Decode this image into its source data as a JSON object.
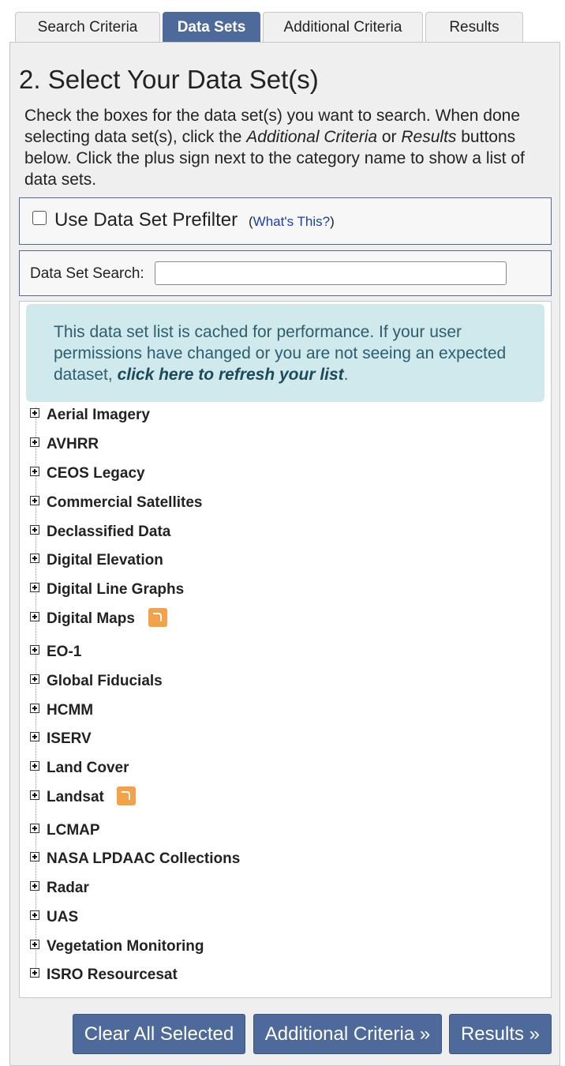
{
  "tabs": [
    "Search Criteria",
    "Data Sets",
    "Additional Criteria",
    "Results"
  ],
  "active_tab": "Data Sets",
  "title": "2. Select Your Data Set(s)",
  "intro": {
    "part1": "Check the boxes for the data set(s) you want to search. When done selecting data set(s), click the ",
    "em1": "Additional Criteria",
    "part2": " or ",
    "em2": "Results",
    "part3": " buttons below. Click the plus sign next to the category name to show a list of data sets."
  },
  "prefilter": {
    "label": "Use Data Set Prefilter",
    "help_open": "(",
    "help_link": "What's This?",
    "help_close": ")",
    "checked": false
  },
  "dataset_search": {
    "label": "Data Set Search:",
    "placeholder": "",
    "value": ""
  },
  "notice": {
    "text": "This data set list is cached for performance. If your user permissions have changed or you are not seeing an expected dataset, ",
    "link": "click here to refresh your list",
    "end": "."
  },
  "categories": [
    {
      "label": "Aerial Imagery"
    },
    {
      "label": "AVHRR"
    },
    {
      "label": "CEOS Legacy"
    },
    {
      "label": "Commercial Satellites"
    },
    {
      "label": "Declassified Data"
    },
    {
      "label": "Digital Elevation"
    },
    {
      "label": "Digital Line Graphs"
    },
    {
      "label": "Digital Maps",
      "icon": "orange-arrow-icon"
    },
    {
      "label": "EO-1"
    },
    {
      "label": "Global Fiducials"
    },
    {
      "label": "HCMM"
    },
    {
      "label": "ISERV"
    },
    {
      "label": "Land Cover"
    },
    {
      "label": "Landsat",
      "icon": "orange-arrow-icon"
    },
    {
      "label": "LCMAP"
    },
    {
      "label": "NASA LPDAAC Collections"
    },
    {
      "label": "Radar"
    },
    {
      "label": "UAS"
    },
    {
      "label": "Vegetation Monitoring"
    },
    {
      "label": "ISRO Resourcesat"
    }
  ],
  "buttons": {
    "clear": "Clear All Selected",
    "additional": "Additional Criteria »",
    "results": "Results »"
  },
  "colors": {
    "accent": "#4e6a9a",
    "notice_bg": "#cfe9ec",
    "icon_orange": "#f3a24a",
    "link": "#1a3fa8"
  }
}
